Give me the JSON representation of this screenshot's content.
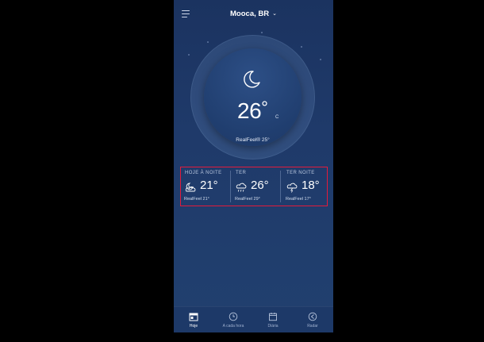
{
  "header": {
    "location": "Mooca, BR",
    "menu_icon": "hamburger-menu-icon",
    "dropdown_icon": "chevron-down-icon"
  },
  "current": {
    "icon": "moon-icon",
    "temperature": "26",
    "degree": "°",
    "unit": "C",
    "realfeel": "RealFeel® 25°"
  },
  "forecast": [
    {
      "label": "HOJE À NOITE",
      "icon": "moon-cloud-icon",
      "temp": "21°",
      "realfeel": "RealFeel 21°"
    },
    {
      "label": "TER",
      "icon": "cloud-rain-icon",
      "temp": "26°",
      "realfeel": "RealFeel 29°"
    },
    {
      "label": "TER NOITE",
      "icon": "cloud-lightning-icon",
      "temp": "18°",
      "realfeel": "RealFeel 17°"
    }
  ],
  "nav": [
    {
      "label": "Hoje",
      "icon": "calendar-today-icon",
      "active": true
    },
    {
      "label": "A cada hora",
      "icon": "clock-icon",
      "active": false
    },
    {
      "label": "Diária",
      "icon": "calendar-icon",
      "active": false
    },
    {
      "label": "Radar",
      "icon": "radar-icon",
      "active": false
    }
  ],
  "colors": {
    "background": "#1f3a6a",
    "highlight_border": "#e21b3c",
    "text": "#ffffff"
  }
}
